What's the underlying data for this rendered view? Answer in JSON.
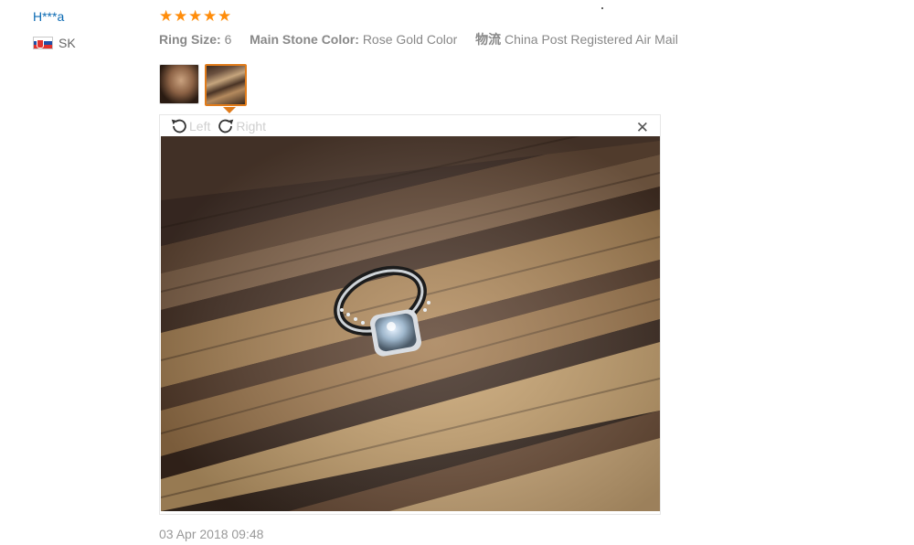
{
  "review": {
    "user": {
      "name": "H***a",
      "country_code": "SK",
      "flag": "slovakia-flag"
    },
    "rating": {
      "stars": 5,
      "max": 5,
      "color": "#ff8d0b"
    },
    "attributes": [
      {
        "label": "Ring Size:",
        "value": "6"
      },
      {
        "label": "Main Stone Color:",
        "value": "Rose Gold Color"
      },
      {
        "label": "物流",
        "value": "China Post Registered Air Mail"
      }
    ],
    "thumbnails": [
      {
        "name": "photo-thumbnail-1",
        "selected": false
      },
      {
        "name": "photo-thumbnail-2",
        "selected": true
      }
    ],
    "viewer": {
      "rotate_left_label": "Left",
      "rotate_right_label": "Right",
      "close_icon": "close-icon",
      "image_subject": "ring-photo"
    },
    "date": "03 Apr 2018 09:48",
    "accent": "#e07b1a",
    "link_color": "#0c6bb4"
  }
}
